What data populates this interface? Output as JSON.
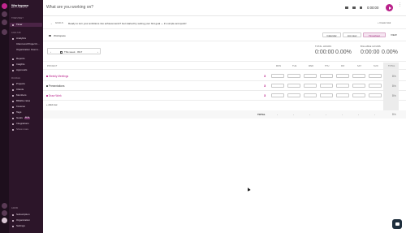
{
  "sidebar": {
    "workspace_name": "Workspace",
    "workspace_sub": "ABOUT PLAN SETUP",
    "sections": [
      {
        "label": "TIMESHEET"
      },
      {
        "label": "ANALYZE"
      },
      {
        "label": "MANAGE"
      },
      {
        "label": "ADMIN"
      }
    ],
    "items": [
      {
        "label": "Timer"
      },
      {
        "label": "Analytics"
      },
      {
        "label": "Client and Project b..."
      },
      {
        "label": "Organization Overvi..."
      },
      {
        "label": "Reports"
      },
      {
        "label": "Insights"
      },
      {
        "label": "Approvals"
      },
      {
        "label": "Projects"
      },
      {
        "label": "Clients"
      },
      {
        "label": "Members"
      },
      {
        "label": "Billable rates"
      },
      {
        "label": "Invoices"
      },
      {
        "label": "Tags"
      },
      {
        "label": "Goals",
        "badge": "BETA"
      },
      {
        "label": "Integrations"
      },
      {
        "label": "Show more"
      },
      {
        "label": "Subscription"
      },
      {
        "label": "Organization"
      },
      {
        "label": "Settings"
      }
    ]
  },
  "topbar": {
    "placeholder": "What are you working on?",
    "timer": "0:00:00"
  },
  "goals": {
    "label": "GOALS",
    "message": "Ready to turn your ambitions into achievements? Get started by setting your first goal — it's simple and quick!",
    "create": "+ Create Goal"
  },
  "workspace_row": {
    "title": "Workspace",
    "views": [
      "Calendar",
      "List view",
      "Timesheet"
    ],
    "active_view": "Timesheet",
    "view_menu": "VIEW"
  },
  "week": {
    "label": "This week · W17"
  },
  "totals": {
    "total_label": "TOTAL HOURS",
    "total_value": "0:00:00",
    "total_pct": "0.00%",
    "billable_label": "BILLABLE HOURS",
    "billable_value": "0:00:00",
    "billable_pct": "0.00%"
  },
  "grid": {
    "project_header": "PROJECT",
    "days": [
      "MON",
      "TUE",
      "WED",
      "THU",
      "FRI",
      "SAT",
      "SUN"
    ],
    "total_header": "TOTAL",
    "rows": [
      {
        "name": "Weekly Meetings",
        "color": "#b9218a",
        "count": "3",
        "total": "0 h"
      },
      {
        "name": "Presentations",
        "color": "#3a3a3a",
        "count": "3",
        "total": "0 h"
      },
      {
        "name": "Draw Work",
        "color": "#b9218a",
        "count": "3",
        "total": "0 h"
      }
    ],
    "add_row": "+ Add row",
    "total_row_label": "TOTAL",
    "total_row_days": [
      "-",
      "-",
      "-",
      "-",
      "-",
      "-",
      "-"
    ],
    "total_row_total": "0 h"
  },
  "colors": {
    "accent": "#b9218a",
    "sidebar_bg": "#2c1529",
    "rail_bg": "#1e0f1d"
  }
}
